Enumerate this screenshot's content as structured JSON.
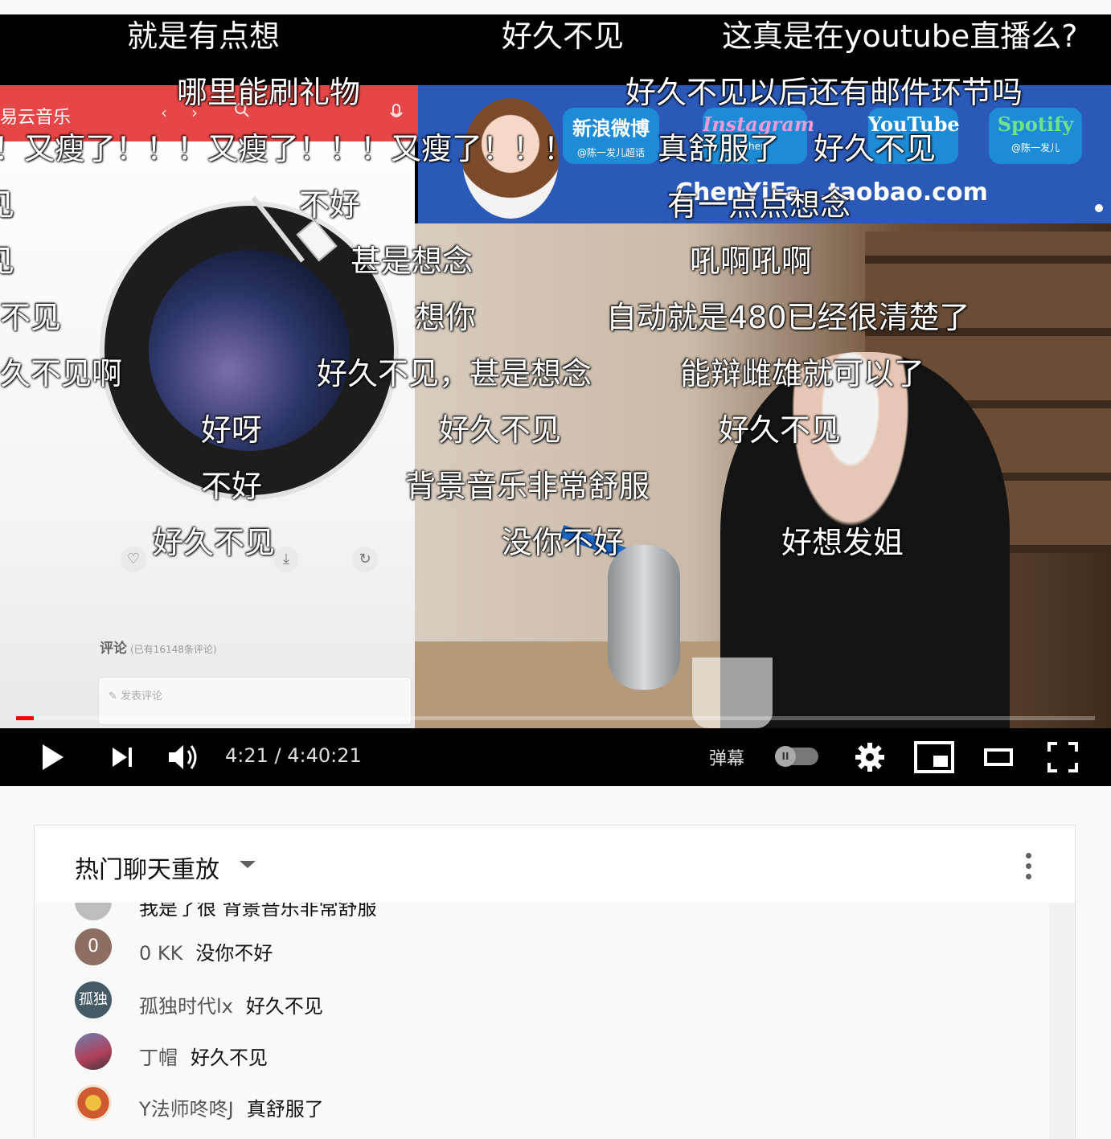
{
  "screen_share": {
    "app_title": "易云音乐",
    "comments_label": "评论",
    "comments_count": "(已有16148条评论)",
    "comment_placeholder": "发表评论"
  },
  "overlay": {
    "badges": [
      {
        "name": "新浪微博",
        "handle": "@陈一发儿超话"
      },
      {
        "name": "Instagram",
        "handle": "chen"
      },
      {
        "name": "YouTube",
        "handle": ""
      },
      {
        "name": "Spotify",
        "handle": "@陈一发儿"
      }
    ],
    "url": "ChenYiFa...taobao.com"
  },
  "danmaku": [
    "就是有点想",
    "好久不见",
    "这真是在youtube直播么?",
    "哪里能刷礼物",
    "好久不见以后还有邮件环节吗",
    "！又瘦了！！！又瘦了！！！又瘦了！！！",
    "真舒服了",
    "好久不见",
    "见",
    "不好",
    "有一点点想念",
    "见",
    "甚是想念",
    "吼啊吼啊",
    "不见",
    "想你",
    "自动就是480已经很清楚了",
    "久不见啊",
    "好久不见，甚是想念",
    "能辩雌雄就可以了",
    "好呀",
    "好久不见",
    "好久不见",
    "不好",
    "背景音乐非常舒服",
    "好久不见",
    "没你不好",
    "好想发姐"
  ],
  "controls": {
    "time": "4:21 / 4:40:21",
    "progress_fraction": 0.0166,
    "danmaku_label": "弹幕"
  },
  "chat": {
    "mode_label": "热门聊天重放",
    "partial_message": "我是了很  背景音乐非常舒服",
    "messages": [
      {
        "avatar": "0",
        "avatar_color": "#8d6e63",
        "author": "0 KK",
        "text": "没你不好"
      },
      {
        "avatar": "孤独",
        "avatar_color": "#455a64",
        "author": "孤独时代lx",
        "text": "好久不见"
      },
      {
        "avatar": "",
        "avatar_color": "#a05a6a",
        "author": "丁帽",
        "text": "好久不见"
      },
      {
        "avatar": "",
        "avatar_color": "#d08a3a",
        "author": "Y法师咚咚J",
        "text": "真舒服了"
      }
    ]
  }
}
